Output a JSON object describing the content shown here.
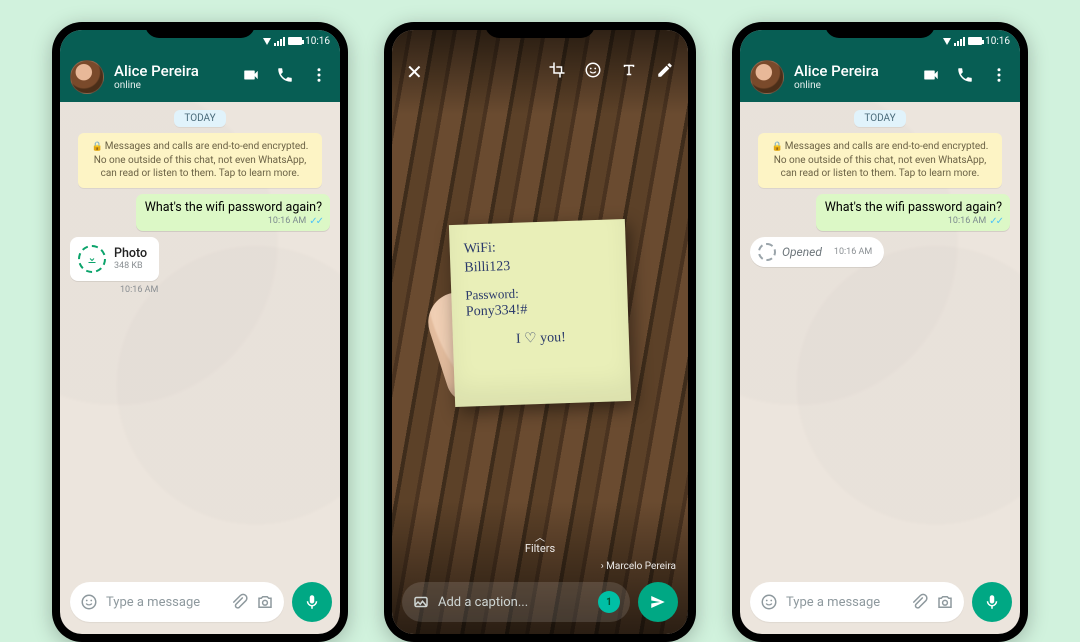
{
  "status": {
    "time": "10:16"
  },
  "chat": {
    "name": "Alice Pereira",
    "presence": "online",
    "date_pill": "TODAY",
    "encryption_notice": "Messages and calls are end-to-end encrypted. No one outside of this chat, not even WhatsApp, can read or listen to them. Tap to learn more.",
    "out_msg": "What's the wifi password again?",
    "out_time": "10:16 AM"
  },
  "photo_chip": {
    "label": "Photo",
    "size": "348 KB",
    "time": "10:16 AM"
  },
  "opened_chip": {
    "label": "Opened",
    "time": "10:16 AM"
  },
  "input": {
    "placeholder": "Type a message"
  },
  "editor": {
    "filters_label": "Filters",
    "caption_placeholder": "Add a caption...",
    "recipient": "› Marcelo Pereira",
    "view_once_badge": "1"
  },
  "note": {
    "l1": "WiFi:",
    "l2": "Billi123",
    "l3": "Password:",
    "l4": "Pony334!#",
    "l5": "I ♡ you!"
  }
}
